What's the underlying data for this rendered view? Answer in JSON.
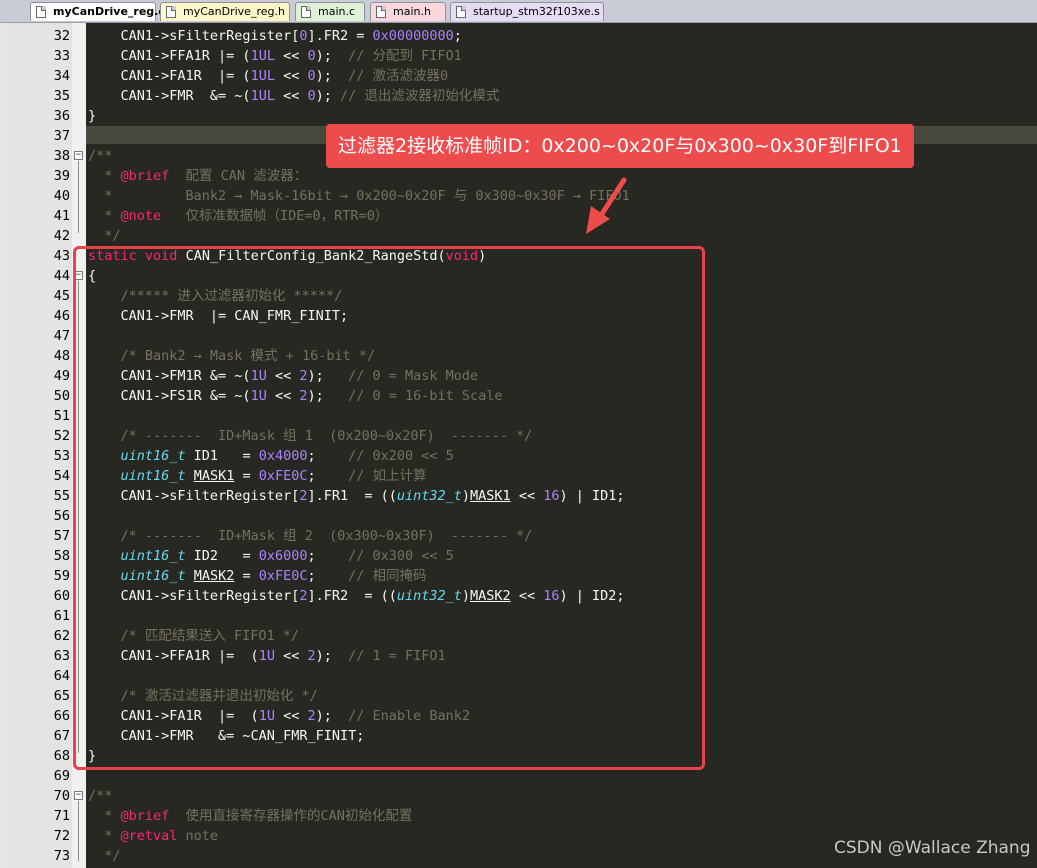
{
  "tabs": [
    {
      "label": "myCanDrive_reg.c",
      "active": true
    },
    {
      "label": "myCanDrive_reg.h",
      "active": false
    },
    {
      "label": "main.c",
      "active": false
    },
    {
      "label": "main.h",
      "active": false
    },
    {
      "label": "startup_stm32f103xe.s",
      "active": false
    }
  ],
  "line_numbers": [
    "32",
    "33",
    "34",
    "35",
    "36",
    "37",
    "38",
    "39",
    "40",
    "41",
    "42",
    "43",
    "44",
    "45",
    "46",
    "47",
    "48",
    "49",
    "50",
    "51",
    "52",
    "53",
    "54",
    "55",
    "56",
    "57",
    "58",
    "59",
    "60",
    "61",
    "62",
    "63",
    "64",
    "65",
    "66",
    "67",
    "68",
    "69",
    "70",
    "71",
    "72",
    "73"
  ],
  "annotation": {
    "callout": "过滤器2接收标准帧ID：0x200~0x20F与0x300~0x30F到FIFO1"
  },
  "watermark": "CSDN @Wallace Zhang",
  "colors": {
    "editor_bg": "#272822",
    "keyword": "#f92672",
    "type": "#66d9ef",
    "number": "#ae81ff",
    "comment": "#75715e",
    "annotation_red": "#e8434d"
  }
}
